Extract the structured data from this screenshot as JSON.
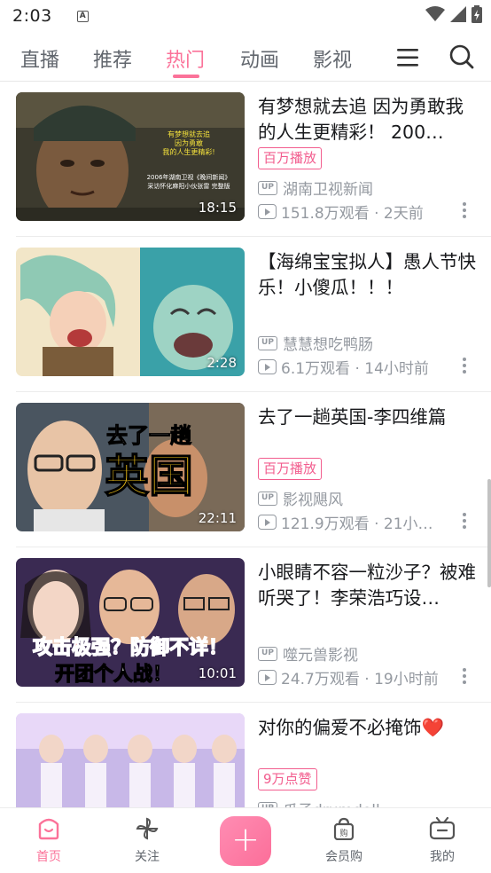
{
  "status": {
    "time": "2:03",
    "notif_icon": "A"
  },
  "tabs": [
    {
      "label": "直播"
    },
    {
      "label": "推荐"
    },
    {
      "label": "热门",
      "active": true
    },
    {
      "label": "动画"
    },
    {
      "label": "影视"
    }
  ],
  "icons": {
    "menu": "menu-icon",
    "search": "search-icon"
  },
  "colors": {
    "accent": "#fb7299",
    "text": "#18191c",
    "meta": "#9499a0",
    "badge": "#f25d8e"
  },
  "feed": [
    {
      "title": "有梦想就去追 因为勇敢我的人生更精彩！ 200…",
      "badge": "百万播放",
      "up": "湖南卫视新闻",
      "views": "151.8万观看 · 2天前",
      "duration": "18:15",
      "thumb_text": [
        "有梦想就去追",
        "因为勇敢",
        "我的人生更精彩!",
        "2006年湖南卫视《晚间新闻》",
        "采访怀化麻阳小伙张雷 完整版"
      ]
    },
    {
      "title": "【海绵宝宝拟人】愚人节快乐！小傻瓜！！！",
      "badge": "",
      "up": "慧慧想吃鸭肠",
      "views": "6.1万观看 · 14小时前",
      "duration": "2:28"
    },
    {
      "title": "去了一趟英国-李四维篇",
      "badge": "百万播放",
      "up": "影视飓风",
      "views": "121.9万观看 · 21小…",
      "duration": "22:11",
      "thumb_text": [
        "去了一趟",
        "英国"
      ]
    },
    {
      "title": "小眼睛不容一粒沙子？被难听哭了！李荣浩巧设…",
      "badge": "",
      "up": "噬元兽影视",
      "views": "24.7万观看 · 19小时前",
      "duration": "10:01",
      "thumb_text": [
        "攻击极强？防御不详！",
        "开团个人战！"
      ]
    },
    {
      "title": "对你的偏爱不必掩饰❤️",
      "badge": "9万点赞",
      "up": "爪子drumdoll",
      "views": "",
      "duration": ""
    }
  ],
  "bottom_nav": [
    {
      "label": "首页",
      "icon": "home-icon",
      "active": true
    },
    {
      "label": "关注",
      "icon": "pinwheel-icon"
    },
    {
      "label": "+",
      "icon": "add-icon"
    },
    {
      "label": "会员购",
      "icon": "shopping-bag-icon"
    },
    {
      "label": "我的",
      "icon": "tv-icon"
    }
  ]
}
